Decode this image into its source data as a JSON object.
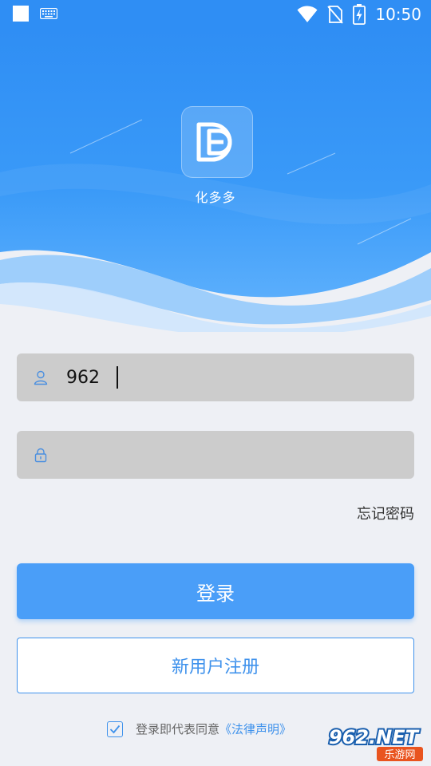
{
  "status_bar": {
    "time": "10:50",
    "icons": [
      "notification-square-icon",
      "keyboard-icon",
      "wifi-icon",
      "no-sim-icon",
      "battery-charging-icon"
    ]
  },
  "app": {
    "name": "化多多",
    "logo_icon": "dd-logo-icon"
  },
  "login_form": {
    "username": {
      "value": "962",
      "icon": "user-icon"
    },
    "password": {
      "value": "",
      "icon": "lock-icon"
    },
    "forgot_password": "忘记密码",
    "login_button": "登录",
    "register_button": "新用户注册",
    "agreement": {
      "checked": true,
      "text": "登录即代表同意",
      "link": "《法律声明》"
    }
  },
  "watermark": {
    "brand": "962.NET",
    "sub": "乐游网"
  },
  "colors": {
    "primary": "#4a9ef8",
    "hero_top": "#2f8ef4",
    "hero_bottom": "#5aaefc",
    "field_bg": "#cccccc",
    "page_bg": "#eef0f5"
  }
}
